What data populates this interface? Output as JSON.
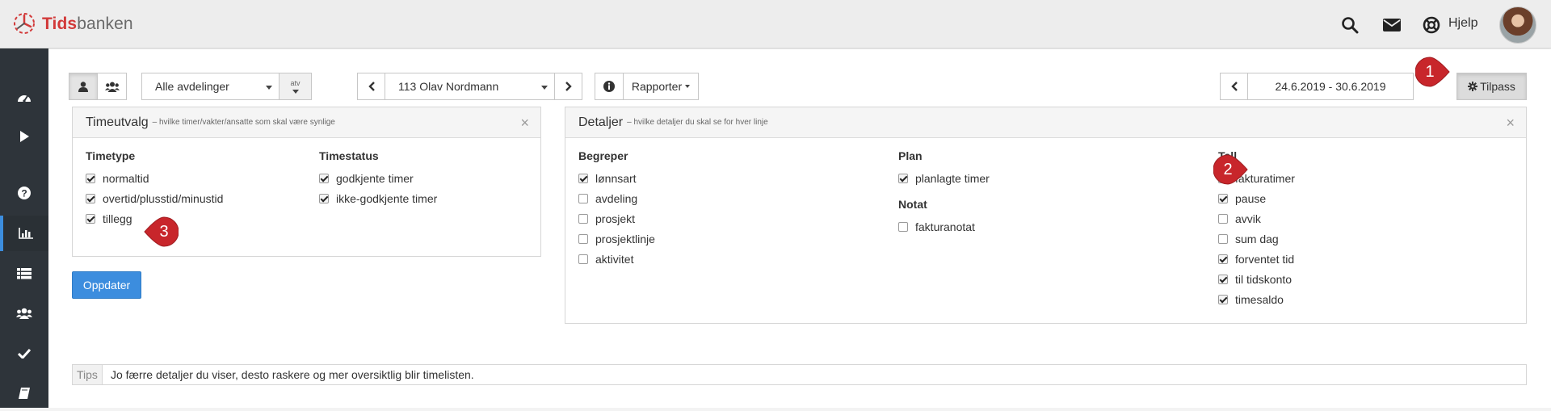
{
  "header": {
    "logo_part1": "Tids",
    "logo_part2": "banken",
    "help_label": "Hjelp"
  },
  "icons": [
    "tidsbanken-logo-icon",
    "search-icon",
    "envelope-icon",
    "lifebuoy-icon",
    "dashboard-icon",
    "play-icon",
    "question-icon",
    "bar-chart-icon",
    "list-icon",
    "users-icon",
    "check-icon",
    "book-icon",
    "user-icon",
    "group-icon",
    "chevron-left-icon",
    "chevron-right-icon",
    "info-icon",
    "gear-icon"
  ],
  "toolbar": {
    "department_select": "Alle avdelinger",
    "sort_label": "atv",
    "employee_select": "113 Olav Nordmann",
    "reports_label": "Rapporter",
    "date_range": "24.6.2019 - 30.6.2019",
    "customize_label": "Tilpass"
  },
  "timeutvalg": {
    "title": "Timeutvalg",
    "subtitle": "– hvilke timer/vakter/ansatte som skal være synlige",
    "close": "×",
    "timetype_header": "Timetype",
    "timetype_items": [
      {
        "label": "normaltid",
        "checked": true
      },
      {
        "label": "overtid/plusstid/minustid",
        "checked": true
      },
      {
        "label": "tillegg",
        "checked": true
      }
    ],
    "timestatus_header": "Timestatus",
    "timestatus_items": [
      {
        "label": "godkjente timer",
        "checked": true
      },
      {
        "label": "ikke-godkjente timer",
        "checked": true
      }
    ]
  },
  "detaljer": {
    "title": "Detaljer",
    "subtitle": "– hvilke detaljer du skal se for hver linje",
    "close": "×",
    "begreper_header": "Begreper",
    "begreper_items": [
      {
        "label": "lønnsart",
        "checked": true
      },
      {
        "label": "avdeling",
        "checked": false
      },
      {
        "label": "prosjekt",
        "checked": false
      },
      {
        "label": "prosjektlinje",
        "checked": false
      },
      {
        "label": "aktivitet",
        "checked": false
      }
    ],
    "plan_header": "Plan",
    "plan_items": [
      {
        "label": "planlagte timer",
        "checked": true
      }
    ],
    "notat_header": "Notat",
    "notat_items": [
      {
        "label": "fakturanotat",
        "checked": false
      }
    ],
    "tall_header": "Tall",
    "tall_items": [
      {
        "label": "fakturatimer",
        "checked": false
      },
      {
        "label": "pause",
        "checked": true
      },
      {
        "label": "avvik",
        "checked": false
      },
      {
        "label": "sum dag",
        "checked": false
      },
      {
        "label": "forventet tid",
        "checked": true
      },
      {
        "label": "til tidskonto",
        "checked": true
      },
      {
        "label": "timesaldo",
        "checked": true
      }
    ]
  },
  "update_button": "Oppdater",
  "tips": {
    "label": "Tips",
    "text": "Jo færre detaljer du viser, desto raskere og mer oversiktlig blir timelisten."
  },
  "markers": [
    "1",
    "2",
    "3"
  ],
  "colors": {
    "brand_red": "#d23a3a",
    "primary_blue": "#3c8dde",
    "marker_red": "#c8262b",
    "sidebar_bg": "#2e343a"
  }
}
